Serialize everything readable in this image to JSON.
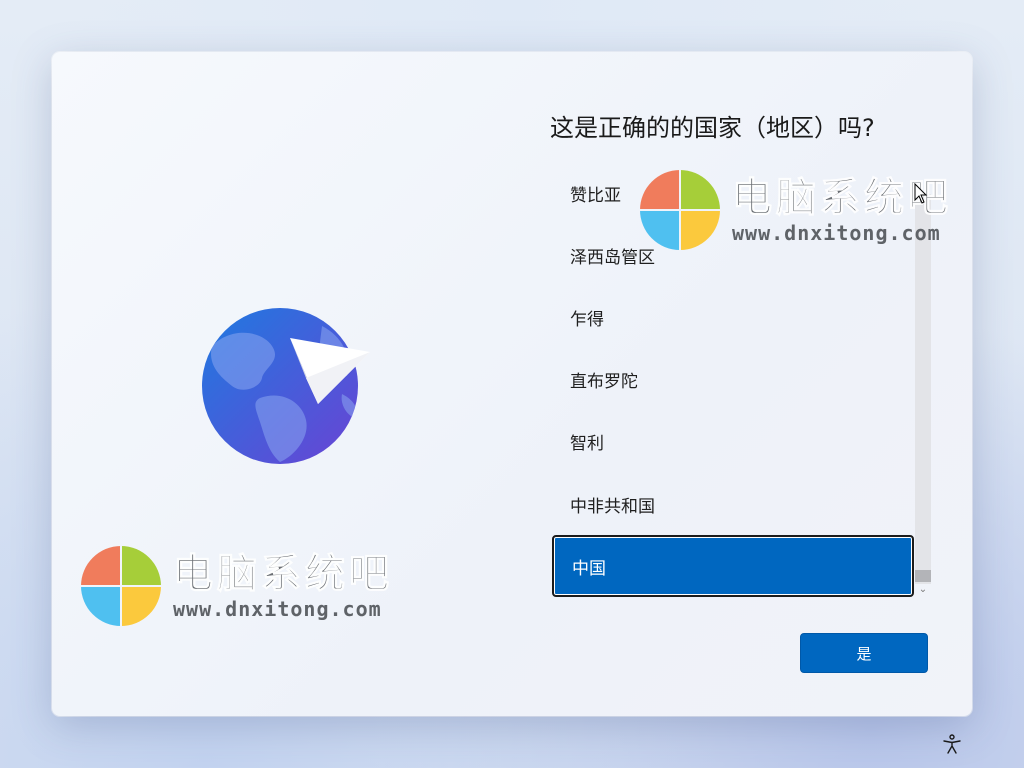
{
  "page": {
    "title": "这是正确的的国家（地区）吗?",
    "yes_button": "是"
  },
  "countries": [
    {
      "label": "赞比亚",
      "selected": false
    },
    {
      "label": "泽西岛管区",
      "selected": false
    },
    {
      "label": "乍得",
      "selected": false
    },
    {
      "label": "直布罗陀",
      "selected": false
    },
    {
      "label": "智利",
      "selected": false
    },
    {
      "label": "中非共和国",
      "selected": false
    },
    {
      "label": "中国",
      "selected": true
    }
  ],
  "watermark": {
    "name": "电脑系统吧",
    "url": "www.dnxitong.com"
  },
  "icons": {
    "illustration": "globe-paper-plane-icon",
    "logo": "four-color-windows-logo",
    "scroll_down": "chevron-down-icon",
    "accessibility": "accessibility-icon",
    "cursor": "mouse-pointer-icon"
  },
  "colors": {
    "accent": "#0067c0",
    "logo_red": "#f07c5c",
    "logo_green": "#a6ce39",
    "logo_blue": "#4fc0f0",
    "logo_yellow": "#fbc93d"
  }
}
